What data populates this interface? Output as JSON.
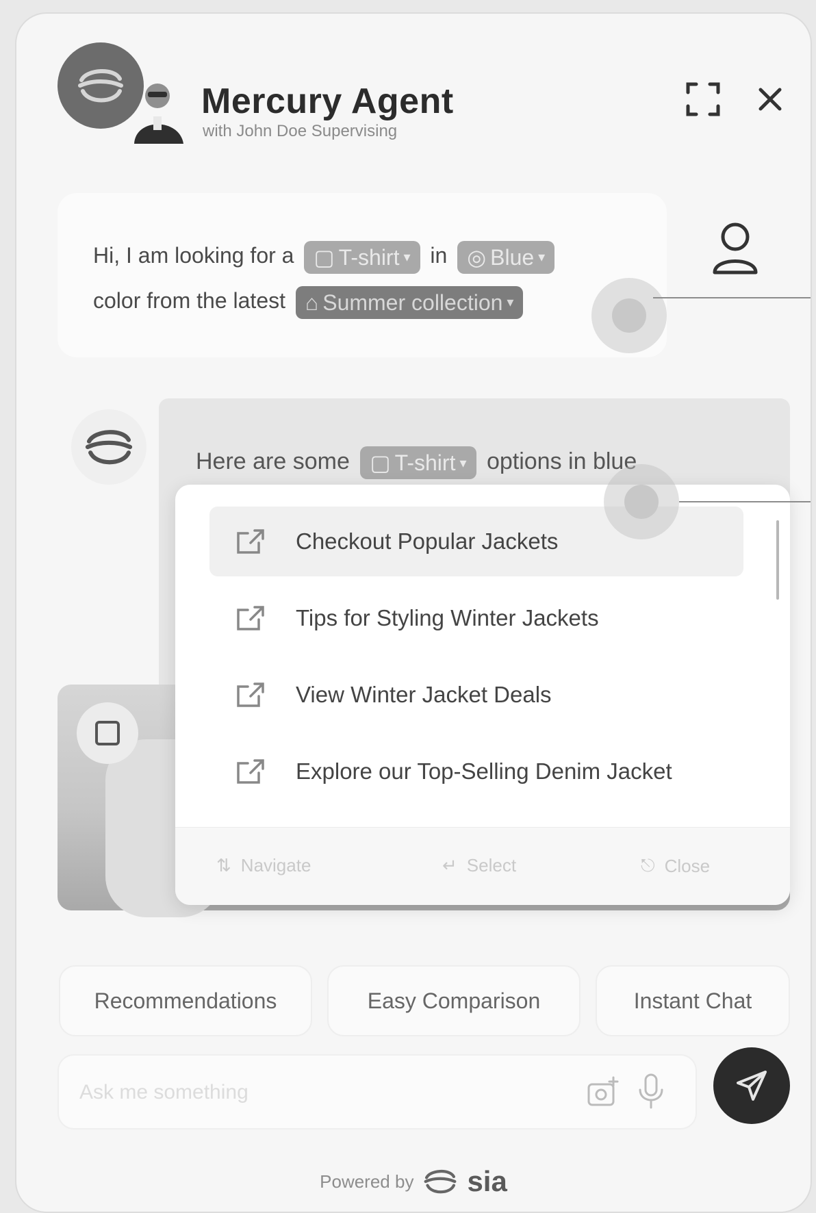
{
  "header": {
    "title": "Mercury Agent",
    "subtitle": "with John Doe Supervising",
    "expand_icon": "expand-icon",
    "close_icon": "close-icon"
  },
  "user_message": {
    "text_part1": "Hi, I am looking for a",
    "chip1": "T-shirt",
    "text_part2": "in",
    "chip2": "Blue",
    "text_part3": "color from the latest",
    "chip3": "Summer collection"
  },
  "agent_message": {
    "text_part1": "Here are some",
    "chip": "T-shirt",
    "text_part2": "options in blue"
  },
  "dropdown": {
    "items": [
      {
        "label": "Checkout Popular Jackets",
        "icon": "external-link-icon"
      },
      {
        "label": "Tips for Styling Winter Jackets",
        "icon": "external-link-icon"
      },
      {
        "label": "View Winter Jacket Deals",
        "icon": "external-link-icon"
      },
      {
        "label": "Explore our Top-Selling Denim Jacket",
        "icon": "external-link-icon"
      }
    ],
    "footer": {
      "navigate": "Navigate",
      "select": "Select",
      "close": "Close"
    }
  },
  "quick_actions": [
    "Recommendations",
    "Easy Comparison",
    "Instant Chat"
  ],
  "input": {
    "placeholder": "Ask me something",
    "value": ""
  },
  "footer": {
    "powered_by": "Powered by",
    "brand": "sia"
  },
  "colors": {
    "send_button": "#2b2b2b",
    "chip_dark": "#7d7d7d",
    "chip_light": "#a9a9a9",
    "background": "#f6f6f6"
  }
}
